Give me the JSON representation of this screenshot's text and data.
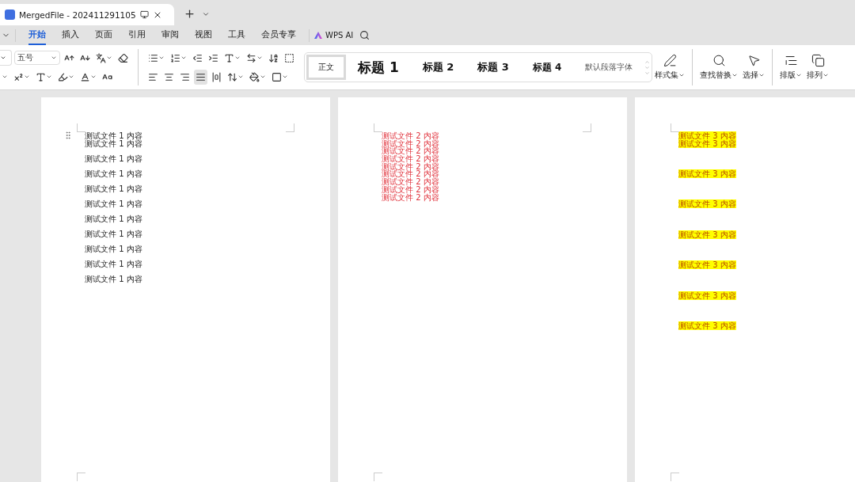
{
  "document_tab": {
    "title": "MergedFile - 202411291105"
  },
  "menu_tabs": [
    {
      "label": "开始",
      "selected": true
    },
    {
      "label": "插入",
      "selected": false
    },
    {
      "label": "页面",
      "selected": false
    },
    {
      "label": "引用",
      "selected": false
    },
    {
      "label": "审阅",
      "selected": false
    },
    {
      "label": "视图",
      "selected": false
    },
    {
      "label": "工具",
      "selected": false
    },
    {
      "label": "会员专享",
      "selected": false
    }
  ],
  "ai_button": {
    "label": "WPS AI"
  },
  "font_size": {
    "value": "五号"
  },
  "align_buttons": [
    {
      "selected": false
    },
    {
      "selected": false
    },
    {
      "selected": false
    },
    {
      "selected": true
    },
    {
      "selected": false
    }
  ],
  "styles": [
    {
      "label": "正文",
      "kind": "normal",
      "selected": true
    },
    {
      "label": "标题 1",
      "kind": "h1",
      "selected": false
    },
    {
      "label": "标题 2",
      "kind": "h2",
      "selected": false
    },
    {
      "label": "标题 3",
      "kind": "h3",
      "selected": false
    },
    {
      "label": "标题 4",
      "kind": "h4",
      "selected": false
    },
    {
      "label": "默认段落字体",
      "kind": "char",
      "selected": false
    }
  ],
  "big_buttons": [
    {
      "label": "样式集",
      "kind": "styles"
    },
    {
      "label": "查找替换",
      "kind": "find"
    },
    {
      "label": "选择",
      "kind": "select"
    },
    {
      "label": "排版",
      "kind": "layout"
    },
    {
      "label": "排列",
      "kind": "arrange"
    }
  ],
  "pages": [
    {
      "kind": "plain",
      "paragraphs": [
        {
          "text": "测试文件 1 内容",
          "kind": "tight"
        },
        {
          "text": "测试文件 1 内容",
          "kind": "tight"
        },
        {
          "text": "测试文件 1 内容",
          "kind": "spaced"
        },
        {
          "text": "测试文件 1 内容",
          "kind": "spaced"
        },
        {
          "text": "测试文件 1 内容",
          "kind": "spaced"
        },
        {
          "text": "测试文件 1 内容",
          "kind": "spaced"
        },
        {
          "text": "测试文件 1 内容",
          "kind": "spaced"
        },
        {
          "text": "测试文件 1 内容",
          "kind": "spaced"
        },
        {
          "text": "测试文件 1 内容",
          "kind": "spaced"
        },
        {
          "text": "测试文件 1 内容",
          "kind": "spaced"
        },
        {
          "text": "测试文件 1 内容",
          "kind": "spaced"
        }
      ]
    },
    {
      "kind": "red",
      "paragraphs": [
        {
          "text": "测试文件 2 内容",
          "kind": "tight"
        },
        {
          "text": "测试文件 2 内容",
          "kind": "tight"
        },
        {
          "text": "测试文件 2 内容",
          "kind": "tight"
        },
        {
          "text": "测试文件 2 内容",
          "kind": "tight"
        },
        {
          "text": "测试文件 2 内容",
          "kind": "tight"
        },
        {
          "text": "测试文件 2 内容",
          "kind": "tight"
        },
        {
          "text": "测试文件 2 内容",
          "kind": "tight"
        },
        {
          "text": "测试文件 2 内容",
          "kind": "tight"
        },
        {
          "text": "测试文件 2 内容",
          "kind": "tight"
        }
      ]
    },
    {
      "kind": "highlight",
      "paragraphs": [
        {
          "text": "测试文件 3 内容",
          "kind": "tight"
        },
        {
          "text": "测试文件 3 内容",
          "kind": "tight"
        },
        {
          "text": "测试文件 3 内容",
          "kind": "wide"
        },
        {
          "text": "测试文件 3 内容",
          "kind": "wide"
        },
        {
          "text": "测试文件 3 内容",
          "kind": "wide"
        },
        {
          "text": "测试文件 3 内容",
          "kind": "wide"
        },
        {
          "text": "测试文件 3 内容",
          "kind": "wide"
        },
        {
          "text": "测试文件 3 内容",
          "kind": "wide"
        }
      ]
    }
  ]
}
